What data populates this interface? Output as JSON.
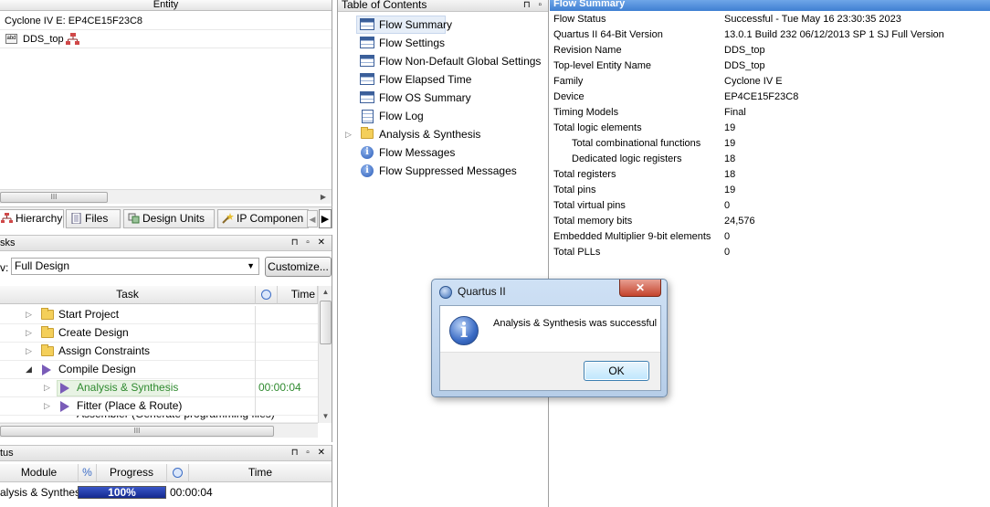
{
  "entity": {
    "column_header": "Entity",
    "device_row": "Cyclone IV E: EP4CE15F23C8",
    "top_row": "DDS_top",
    "scroll_grip": "III"
  },
  "nav_tabs": [
    {
      "label": "Hierarchy"
    },
    {
      "label": "Files"
    },
    {
      "label": "Design Units"
    },
    {
      "label": "IP Componen"
    }
  ],
  "tasks": {
    "title": "sks",
    "flow_label": "v:",
    "flow_value": "Full Design",
    "customize_label": "Customize...",
    "col_task": "Task",
    "col_time": "Time",
    "rows": [
      {
        "label": "Start Project",
        "time": ""
      },
      {
        "label": "Create Design",
        "time": ""
      },
      {
        "label": "Assign Constraints",
        "time": ""
      },
      {
        "label": "Compile Design",
        "time": ""
      },
      {
        "label": "Analysis & Synthesis",
        "time": "00:00:04"
      },
      {
        "label": "Fitter (Place & Route)",
        "time": ""
      },
      {
        "label": "Assembler (Generate programming files)",
        "time": ""
      }
    ],
    "scroll_grip": "III",
    "panel_buttons": "⊓ ▫ ✕"
  },
  "status": {
    "title": "tus",
    "col_module": "Module",
    "col_percent": "%",
    "col_progress": "Progress",
    "col_time": "Time",
    "row_module": "alysis & Synthesis",
    "row_progress_text": "100%",
    "row_progress": 1.0,
    "row_time": "00:00:04",
    "panel_buttons": "⊓ ▫ ✕"
  },
  "toc": {
    "title": "Table of Contents",
    "panel_buttons": "⊓ ▫",
    "items": [
      {
        "label": "Flow Summary",
        "icon": "table-icon"
      },
      {
        "label": "Flow Settings",
        "icon": "table-icon"
      },
      {
        "label": "Flow Non-Default Global Settings",
        "icon": "table-icon"
      },
      {
        "label": "Flow Elapsed Time",
        "icon": "table-icon"
      },
      {
        "label": "Flow OS Summary",
        "icon": "table-icon"
      },
      {
        "label": "Flow Log",
        "icon": "log-icon"
      },
      {
        "label": "Analysis & Synthesis",
        "icon": "folder-icon"
      },
      {
        "label": "Flow Messages",
        "icon": "info-icon"
      },
      {
        "label": "Flow Suppressed Messages",
        "icon": "info-icon"
      }
    ]
  },
  "flow_summary": {
    "title": "Flow Summary",
    "rows": [
      {
        "key": "Flow Status",
        "value": "Successful - Tue May 16 23:30:35 2023"
      },
      {
        "key": "Quartus II 64-Bit Version",
        "value": "13.0.1 Build 232 06/12/2013 SP 1 SJ Full Version"
      },
      {
        "key": "Revision Name",
        "value": "DDS_top"
      },
      {
        "key": "Top-level Entity Name",
        "value": "DDS_top"
      },
      {
        "key": "Family",
        "value": "Cyclone IV E"
      },
      {
        "key": "Device",
        "value": "EP4CE15F23C8"
      },
      {
        "key": "Timing Models",
        "value": "Final"
      },
      {
        "key": "Total logic elements",
        "value": "19"
      },
      {
        "key": "Total combinational functions",
        "value": "19"
      },
      {
        "key": "Dedicated logic registers",
        "value": "18"
      },
      {
        "key": "Total registers",
        "value": "18"
      },
      {
        "key": "Total pins",
        "value": "19"
      },
      {
        "key": "Total virtual pins",
        "value": "0"
      },
      {
        "key": "Total memory bits",
        "value": "24,576"
      },
      {
        "key": "Embedded Multiplier 9-bit elements",
        "value": "0"
      },
      {
        "key": "Total PLLs",
        "value": "0"
      }
    ]
  },
  "dialog": {
    "title": "Quartus II",
    "close_glyph": "✕",
    "message": "Analysis & Synthesis was successful",
    "ok_label": "OK",
    "info_glyph": "i"
  },
  "colors": {
    "selection_green": "#2f8a2f",
    "progress_blue": "#1c3aa8",
    "title_blue": "#4a88d8"
  }
}
